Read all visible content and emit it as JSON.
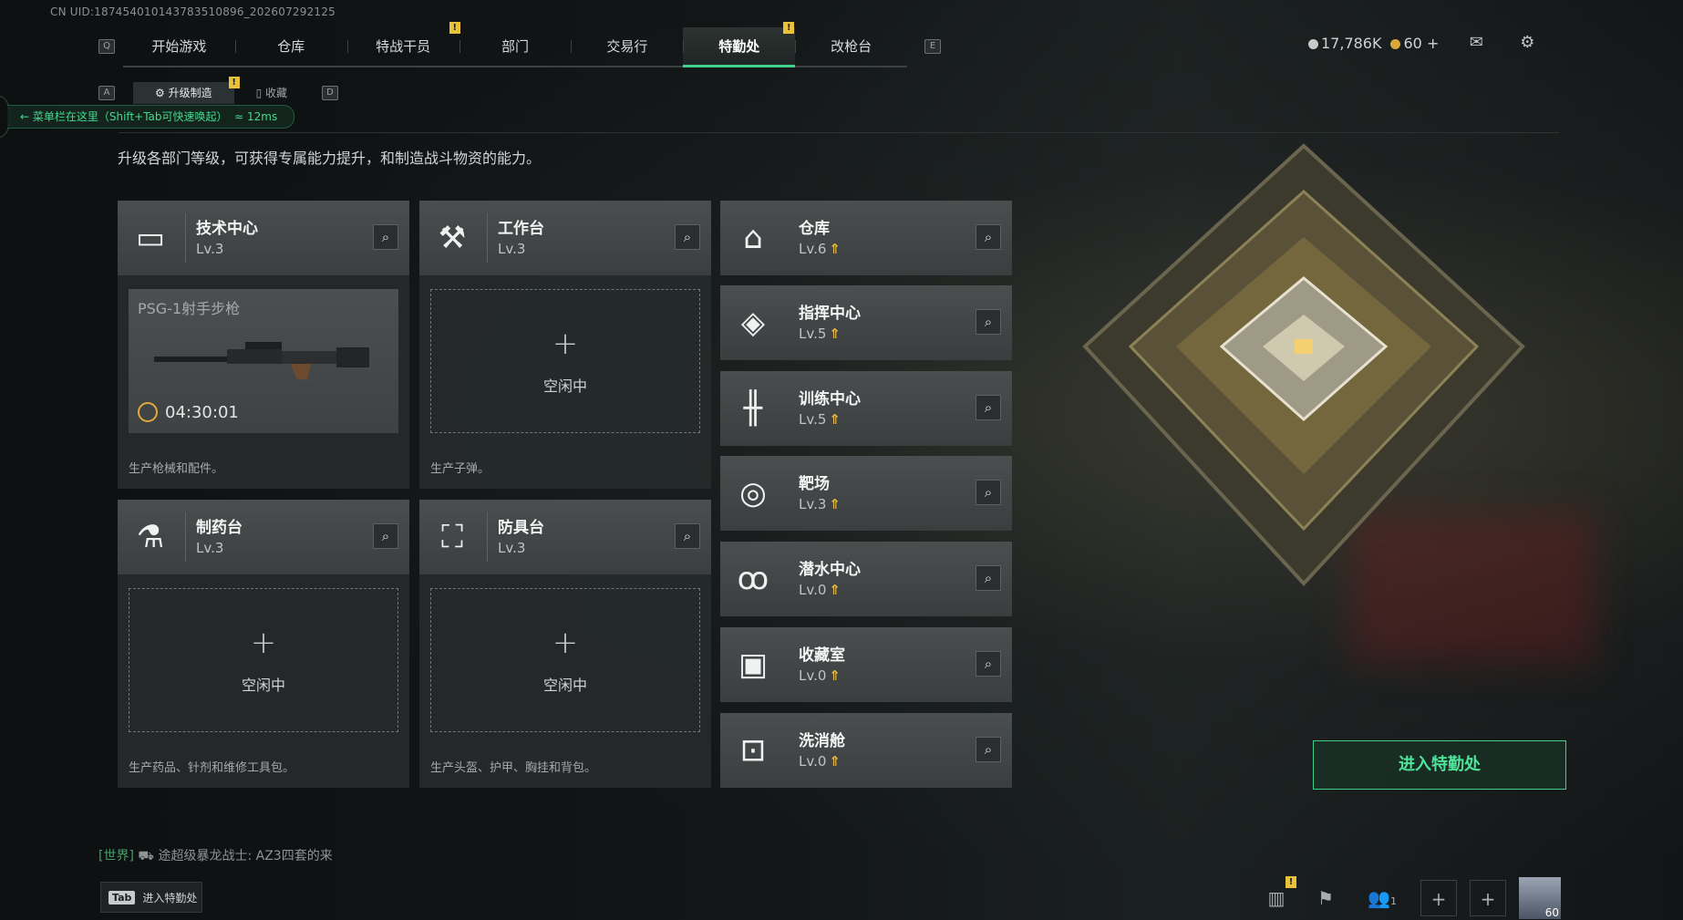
{
  "uid": "CN UID:1874540101437835108​96_202607292125",
  "nav": {
    "key_left": "Q",
    "key_right": "E",
    "tabs": [
      "开始游戏",
      "仓库",
      "特战干员",
      "部门",
      "交易行",
      "特勤处",
      "改枪台"
    ],
    "active_tab": "特勤处"
  },
  "currency": {
    "coins": "17,786K",
    "gold": "60"
  },
  "subnav": {
    "key_left": "A",
    "key_right": "D",
    "tabs": [
      "升级制造",
      "收藏"
    ]
  },
  "tip": {
    "text": "菜单栏在这里（Shift+Tab可快速唤起）",
    "ping": "12ms"
  },
  "description": "升级各部门等级，可获得专属能力提升，和制造战斗物资的能力。",
  "production": [
    {
      "name": "技术中心",
      "level": "Lv.3",
      "icon": "computer-icon",
      "status": "filled",
      "item": "PSG-1射手步枪",
      "timer": "04:30:01",
      "desc": "生产枪械和配件。"
    },
    {
      "name": "工作台",
      "level": "Lv.3",
      "icon": "tools-icon",
      "status": "empty",
      "idle": "空闲中",
      "desc": "生产子弹。"
    },
    {
      "name": "制药台",
      "level": "Lv.3",
      "icon": "microscope-icon",
      "status": "empty",
      "idle": "空闲中",
      "desc": "生产药品、针剂和维修工具包。"
    },
    {
      "name": "防具台",
      "level": "Lv.3",
      "icon": "cubes-icon",
      "status": "empty",
      "idle": "空闲中",
      "desc": "生产头盔、护甲、胸挂和背包。"
    }
  ],
  "departments": [
    {
      "name": "仓库",
      "level": "Lv.6",
      "icon": "warehouse-icon"
    },
    {
      "name": "指挥中心",
      "level": "Lv.5",
      "icon": "command-icon"
    },
    {
      "name": "训练中心",
      "level": "Lv.5",
      "icon": "dumbbell-icon"
    },
    {
      "name": "靶场",
      "level": "Lv.3",
      "icon": "target-icon"
    },
    {
      "name": "潜水中心",
      "level": "Lv.0",
      "icon": "diving-mask-icon"
    },
    {
      "name": "收藏室",
      "level": "Lv.0",
      "icon": "collection-icon"
    },
    {
      "name": "洗消舱",
      "level": "Lv.0",
      "icon": "decon-icon"
    }
  ],
  "enter_button": "进入特勤处",
  "chat": {
    "channel": "[世界]",
    "sender": "途超级暴龙战士:",
    "message": "AZ3四套的来"
  },
  "tab_hint": {
    "key": "Tab",
    "label": "进入特勤处"
  },
  "player_level": "60",
  "friends_count": "1"
}
